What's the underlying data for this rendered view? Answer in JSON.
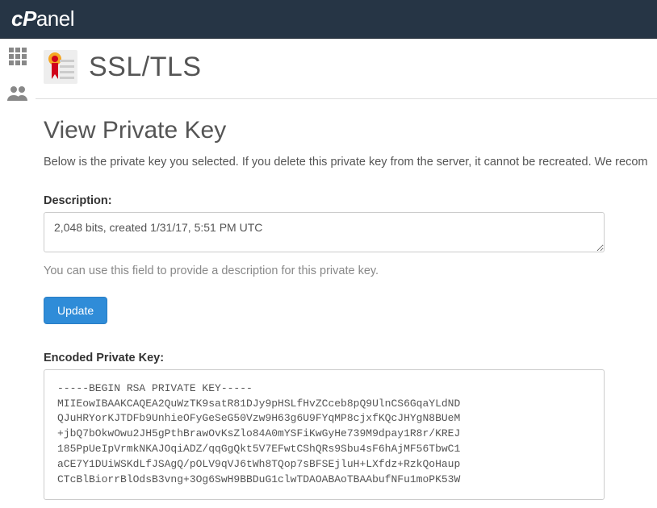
{
  "header": {
    "brand": "cPanel"
  },
  "page": {
    "title": "SSL/TLS",
    "section_title": "View Private Key",
    "intro": "Below is the private key you selected. If you delete this private key from the server, it cannot be recreated. We recom"
  },
  "description": {
    "label": "Description:",
    "value": "2,048 bits, created 1/31/17, 5:51 PM UTC",
    "hint": "You can use this field to provide a description for this private key."
  },
  "buttons": {
    "update": "Update"
  },
  "encoded": {
    "label": "Encoded Private Key:",
    "text": "-----BEGIN RSA PRIVATE KEY-----\nMIIEowIBAAKCAQEA2QuWzTK9satR81DJy9pHSLfHvZCceb8pQ9UlnCS6GqaYLdND\nQJuHRYorKJTDFb9UnhieOFyGeSeG50Vzw9H63g6U9FYqMP8cjxfKQcJHYgN8BUeM\n+jbQ7bOkwOwu2JH5gPthBrawOvKsZlo84A0mYSFiKwGyHe739M9dpay1R8r/KREJ\n185PpUeIpVrmkNKAJOqiADZ/qqGgQkt5V7EFwtCShQRs9Sbu4sF6hAjMF56TbwC1\naCE7Y1DUiWSKdLfJSAgQ/pOLV9qVJ6tWh8TQop7sBFSEjluH+LXfdz+RzkQoHaup\nCTcBlBiorrBlOdsB3vng+3Og6SwH9BBDuG1clwTDAOABAoTBAAbufNFu1moPK53W"
  }
}
